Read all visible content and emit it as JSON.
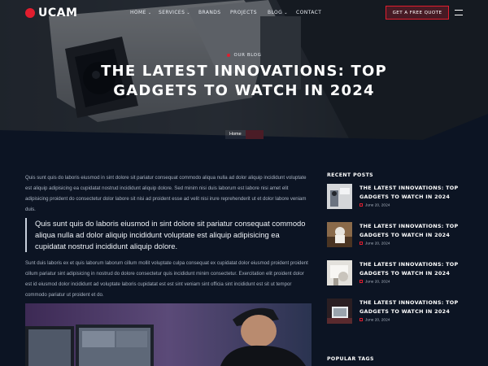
{
  "brand": {
    "name": "UCAM",
    "accent": "#e11d2e"
  },
  "nav": {
    "items": [
      {
        "label": "HOME",
        "has_dropdown": true
      },
      {
        "label": "SERVICES",
        "has_dropdown": true
      },
      {
        "label": "BRANDS",
        "has_dropdown": false
      },
      {
        "label": "PROJECTS",
        "has_dropdown": false
      },
      {
        "label": "BLOG",
        "has_dropdown": true
      },
      {
        "label": "CONTACT",
        "has_dropdown": false
      }
    ],
    "cta": "GET A FREE QUOTE",
    "menu_icon": "hamburger-icon"
  },
  "hero": {
    "kicker": "OUR BLOG",
    "title": "THE LATEST INNOVATIONS: TOP GADGETS TO WATCH IN 2024",
    "breadcrumb": {
      "home": "Home"
    }
  },
  "article": {
    "intro": "Quis sunt quis do laboris eiusmod in sint dolore sit pariatur consequat commodo aliqua nulla ad dolor aliquip incididunt voluptate est aliquip adipisicing ea cupidatat nostrud incididunt aliquip dolore. Sed minim nisi duis laborum est labore nisi amet elit adipisicing proident do consectetur dolor labore sit nisi ad proident esse ad velit nisi irure reprehenderit ut et dolor labore veniam duis.",
    "quote": "Quis sunt quis do laboris eiusmod in sint dolore sit pariatur consequat commodo aliqua nulla ad dolor aliquip incididunt voluptate est aliquip adipisicing ea cupidatat nostrud incididunt aliquip dolore.",
    "body": "Sunt duis laboris ex et quis laborum laborum cillum mollit voluptate culpa consequat ex cupidatat dolor eiusmod proident proident cillum pariatur sint adipisicing in nostrud do dolore consectetur quis incididunt minim consectetur. Exercitation elit proident dolor est id eiusmod dolor incididunt ad voluptate laboris cupidatat est est sint veniam sint officia sint incididunt est sit ut tempor commodo pariatur ut proident et do."
  },
  "sidebar": {
    "recent_title": "RECENT POSTS",
    "posts": [
      {
        "title": "THE LATEST INNOVATIONS: TOP GADGETS TO WATCH IN 2024",
        "date": "June 20, 2024"
      },
      {
        "title": "THE LATEST INNOVATIONS: TOP GADGETS TO WATCH IN 2024",
        "date": "June 20, 2024"
      },
      {
        "title": "THE LATEST INNOVATIONS: TOP GADGETS TO WATCH IN 2024",
        "date": "June 20, 2024"
      },
      {
        "title": "THE LATEST INNOVATIONS: TOP GADGETS TO WATCH IN 2024",
        "date": "June 20, 2024"
      }
    ],
    "tags_title": "POPULAR TAGS"
  }
}
